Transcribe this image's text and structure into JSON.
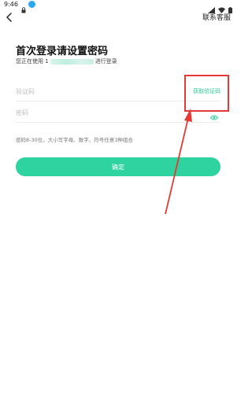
{
  "status_bar": {
    "time": "9:46",
    "icons": [
      "lock-icon",
      "app-notification-icon",
      "signal-icon",
      "wifi-icon",
      "battery-icon"
    ]
  },
  "header": {
    "back_icon": "chevron-left-icon",
    "contact_label": "联系客服"
  },
  "main": {
    "title": "首次登录请设置密码",
    "subtitle_prefix": "您正在使用 1",
    "subtitle_suffix": "进行登录",
    "code_field": {
      "placeholder": "验证码",
      "value": "",
      "action_label": "获取验证码"
    },
    "password_field": {
      "placeholder": "密码",
      "value": "",
      "toggle_icon": "eye-icon"
    },
    "password_rule": "密码8-30位，大小写字母、数字、符号任意3种组合",
    "confirm_label": "确定"
  },
  "annotation": {
    "box_color": "#e53935",
    "arrow_color": "#e53935"
  },
  "colors": {
    "accent": "#2ed39f",
    "link": "#2bcf95"
  }
}
